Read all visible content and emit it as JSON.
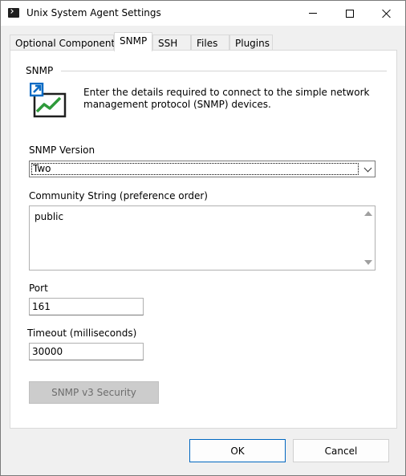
{
  "window": {
    "title": "Unix System Agent Settings"
  },
  "tabs": [
    {
      "label": "Optional Components",
      "active": false
    },
    {
      "label": "SNMP",
      "active": true
    },
    {
      "label": "SSH",
      "active": false
    },
    {
      "label": "Files",
      "active": false
    },
    {
      "label": "Plugins",
      "active": false
    }
  ],
  "snmp": {
    "group_label": "SNMP",
    "icon": "snmp-chart-icon",
    "description": "Enter the details required to connect to the simple network management protocol (SNMP) devices.",
    "version_label": "SNMP Version",
    "version_value": "Two",
    "community_label": "Community String (preference order)",
    "community_value": "public",
    "port_label": "Port",
    "port_value": "161",
    "timeout_label": "Timeout (milliseconds)",
    "timeout_value": "30000",
    "v3_button": "SNMP v3 Security"
  },
  "footer": {
    "ok": "OK",
    "cancel": "Cancel"
  },
  "colors": {
    "accent": "#0067c0",
    "icon_green": "#2e9a3a",
    "icon_blue": "#0a6bc4"
  }
}
